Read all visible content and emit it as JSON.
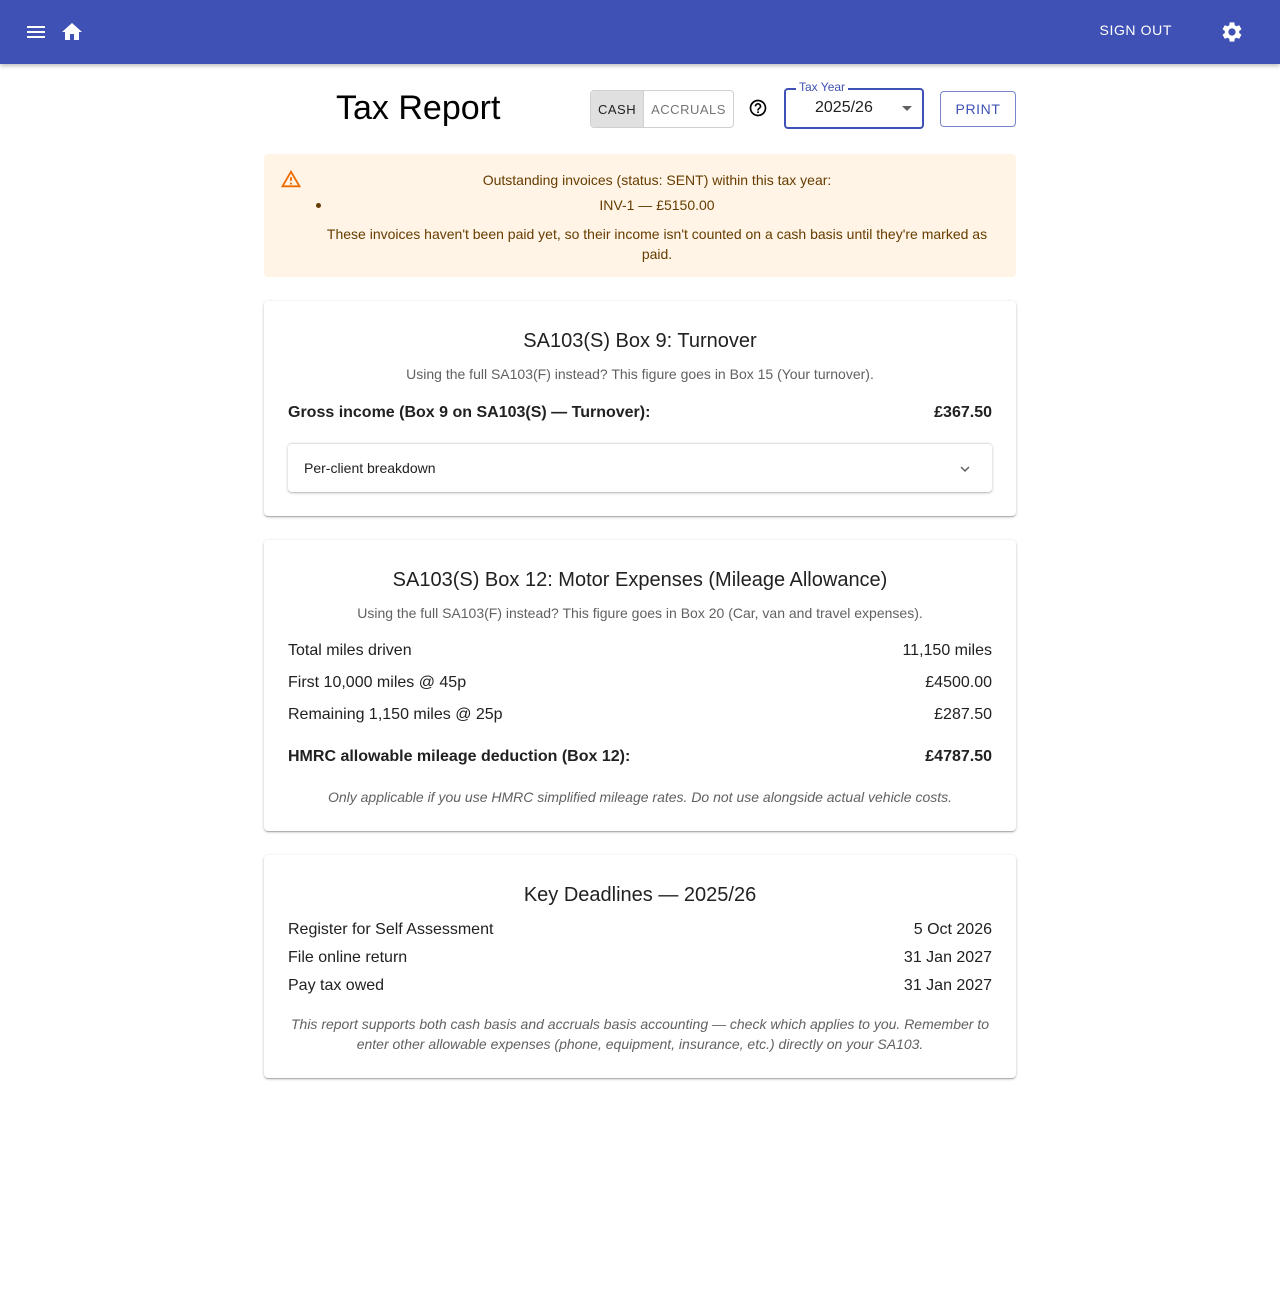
{
  "appbar": {
    "menu_icon": "menu-icon",
    "home_icon": "home-icon",
    "sign_out_label": "SIGN OUT",
    "settings_icon": "gear-icon",
    "color": "#3f51b5"
  },
  "header": {
    "title": "Tax Report",
    "basis_toggle": [
      {
        "label": "CASH",
        "selected": true
      },
      {
        "label": "ACCRUALS",
        "selected": false
      }
    ],
    "help_icon": "help-circle-icon",
    "tax_year": {
      "label": "Tax Year",
      "value": "2025/26"
    },
    "print_label": "PRINT"
  },
  "alert": {
    "icon": "warning-icon",
    "message": "Outstanding invoices (status: SENT) within this tax year:",
    "items": [
      "INV-1 — £5150.00"
    ],
    "note": "These invoices haven't been paid yet, so their income isn't counted on a cash basis until they're marked as paid."
  },
  "turnover": {
    "title": "SA103(S) Box 9: Turnover",
    "subtitle": "Using the full SA103(F) instead? This figure goes in Box 15 (Your turnover).",
    "gross_label": "Gross income (Box 9 on SA103(S) — Turnover):",
    "gross_value": "£367.50",
    "breakdown_label": "Per-client breakdown"
  },
  "mileage": {
    "title": "SA103(S) Box 12: Motor Expenses (Mileage Allowance)",
    "subtitle": "Using the full SA103(F) instead? This figure goes in Box 20 (Car, van and travel expenses).",
    "rows": [
      {
        "label": "Total miles driven",
        "value": "11,150 miles"
      },
      {
        "label": "First 10,000 miles @ 45p",
        "value": "£4500.00"
      },
      {
        "label": "Remaining 1,150 miles @ 25p",
        "value": "£287.50"
      }
    ],
    "total_label": "HMRC allowable mileage deduction (Box 12):",
    "total_value": "£4787.50",
    "footnote": "Only applicable if you use HMRC simplified mileage rates. Do not use alongside actual vehicle costs."
  },
  "deadlines": {
    "title": "Key Deadlines — 2025/26",
    "rows": [
      {
        "label": "Register for Self Assessment",
        "value": "5 Oct 2026"
      },
      {
        "label": "File online return",
        "value": "31 Jan 2027"
      },
      {
        "label": "Pay tax owed",
        "value": "31 Jan 2027"
      }
    ],
    "footnote": "This report supports both cash basis and accruals basis accounting — check which applies to you. Remember to enter other allowable expenses (phone, equipment, insurance, etc.) directly on your SA103."
  }
}
